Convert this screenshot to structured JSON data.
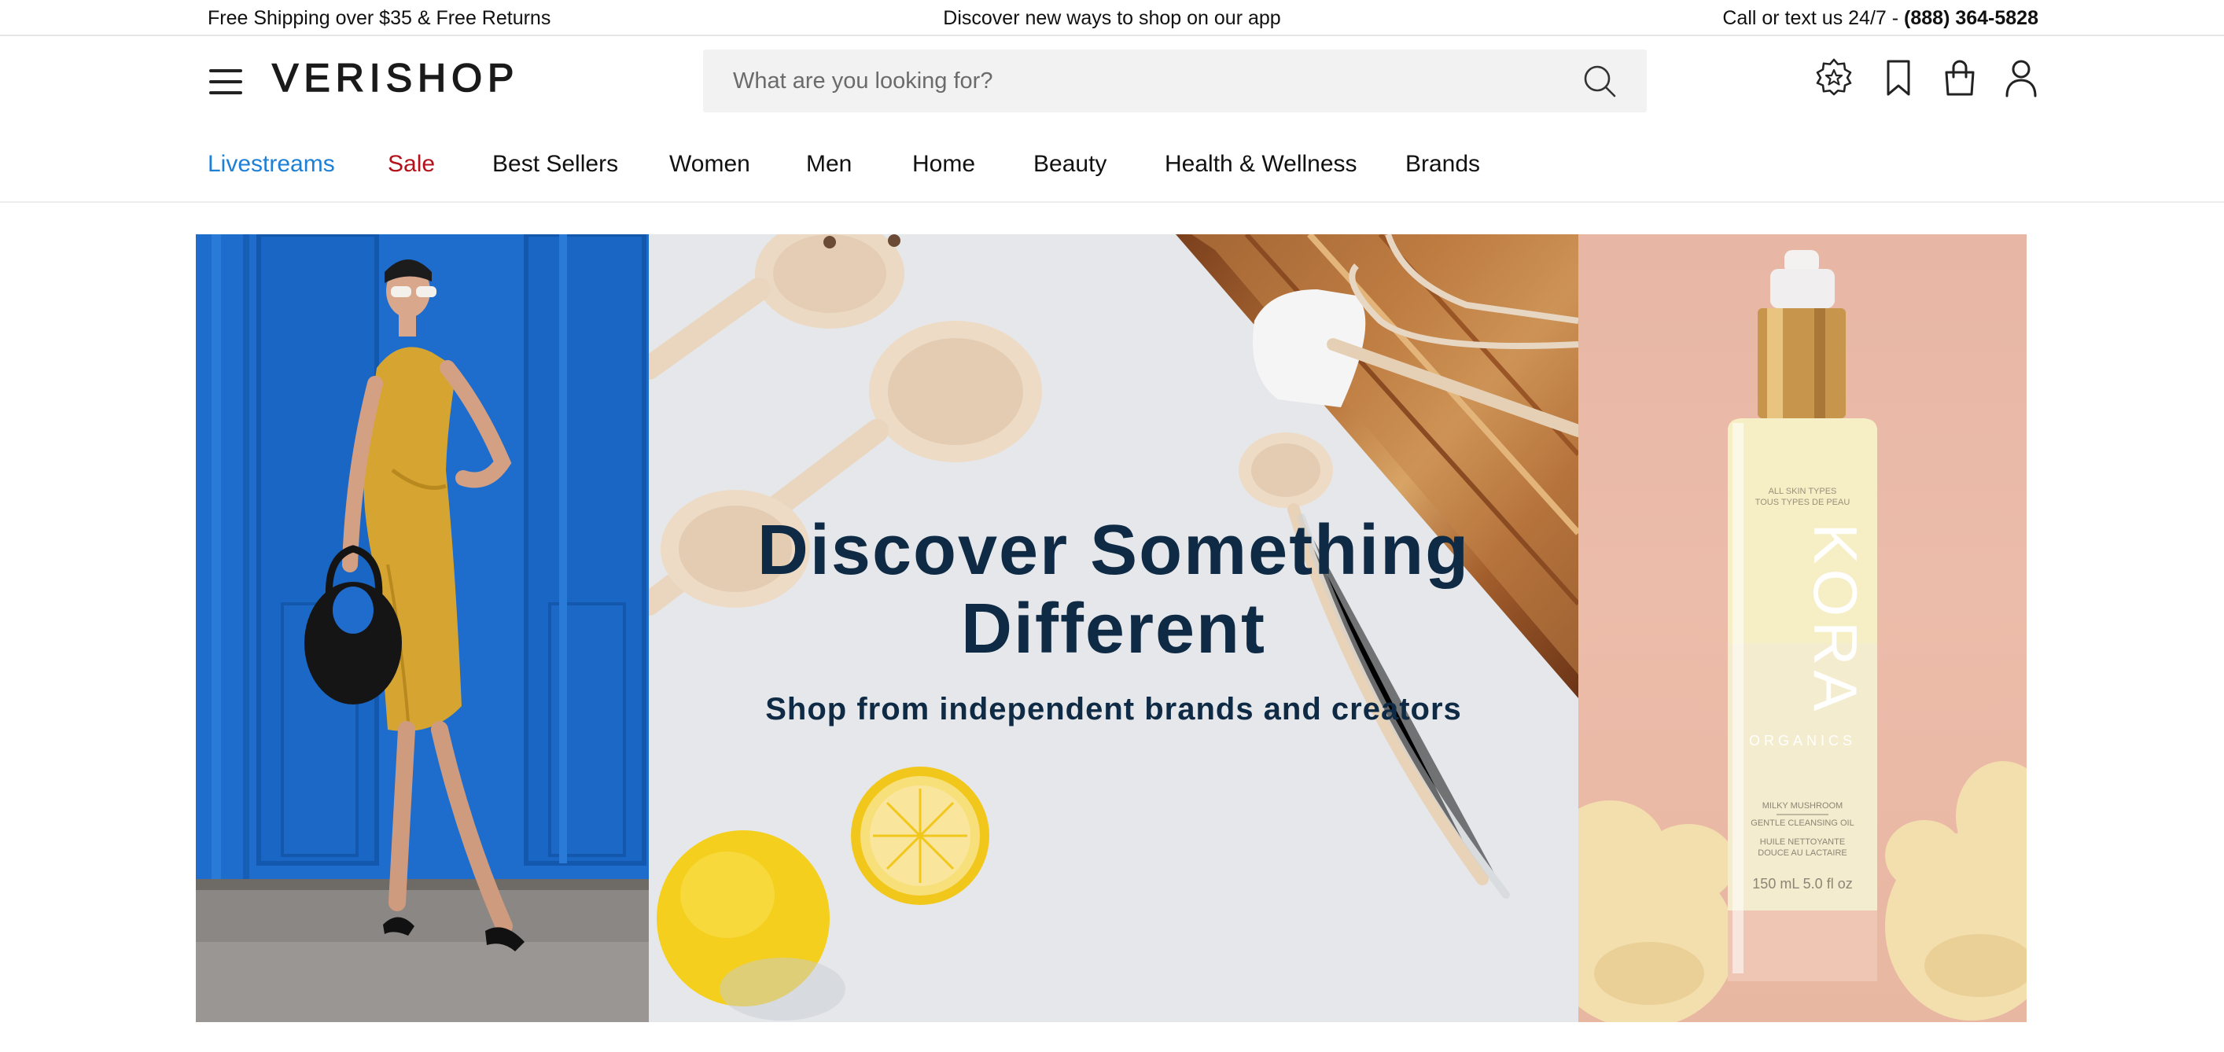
{
  "announcement": {
    "left": "Free Shipping over $35 & Free Returns",
    "center": "Discover new ways to shop on our app",
    "right_prefix": "Call or text us 24/7 - ",
    "phone": "(888) 364-5828"
  },
  "header": {
    "logo": "VERISHOP",
    "search_placeholder": "What are you looking for?",
    "icons": [
      "rewards-badge-icon",
      "bookmark-icon",
      "shopping-bag-icon",
      "account-icon"
    ]
  },
  "nav": {
    "items": [
      {
        "label": "Livestreams",
        "color": "#1e7fd6"
      },
      {
        "label": "Sale",
        "color": "#b3121b"
      },
      {
        "label": "Best Sellers"
      },
      {
        "label": "Women"
      },
      {
        "label": "Men"
      },
      {
        "label": "Home"
      },
      {
        "label": "Beauty"
      },
      {
        "label": "Health & Wellness"
      },
      {
        "label": "Brands"
      }
    ]
  },
  "hero": {
    "title_line1": "Discover Something",
    "title_line2": "Different",
    "subtitle": "Shop from independent brands and creators",
    "product_label": {
      "brand": "KORA",
      "sub": "ORGANICS",
      "top": "ALL SKIN TYPES",
      "top2": "TOUS TYPES DE PEAU",
      "name1": "MILKY MUSHROOM",
      "name2": "GENTLE CLEANSING OIL",
      "name3": "HUILE NETTOYANTE",
      "name4": "DOUCE AU LACTAIRE",
      "size": "150 mL 5.0 fl oz"
    }
  },
  "colors": {
    "accent_blue": "#1e7fd6",
    "sale_red": "#b3121b",
    "hero_text": "#0e2a44"
  }
}
